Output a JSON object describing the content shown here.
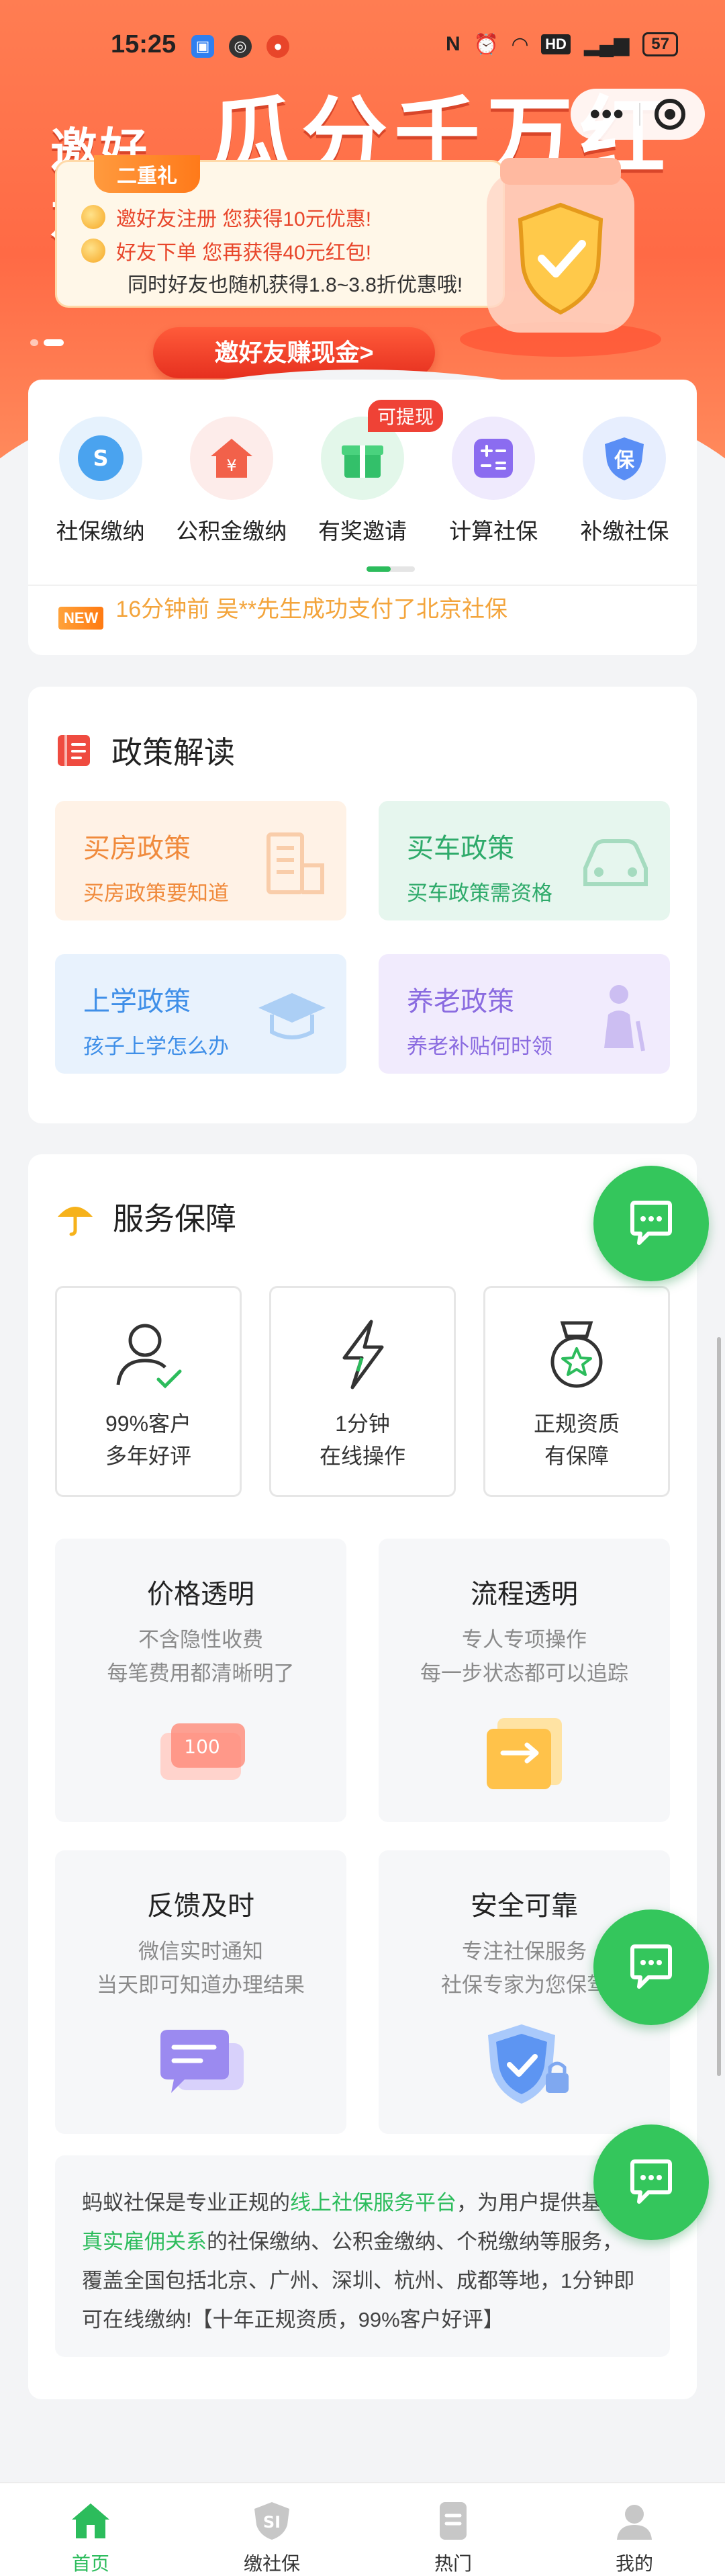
{
  "status_bar": {
    "time": "15:25",
    "battery": "57",
    "network": "HD"
  },
  "banner": {
    "headline_left": "邀好友",
    "headline_right": "瓜分千万红包",
    "gift_tag": "二重礼",
    "line1": "邀好友注册 您获得10元优惠!",
    "line2": "好友下单 您再获得40元红包!",
    "line3": "同时好友也随机获得1.8~3.8折优惠哦!",
    "invite_button": "邀好友赚现金>"
  },
  "quick_services": [
    {
      "label": "社保缴纳",
      "icon": "social-security-icon",
      "color": "#4aa3ef",
      "bg": "#e6f2fd"
    },
    {
      "label": "公积金缴纳",
      "icon": "housing-fund-icon",
      "color": "#f2614a",
      "bg": "#fdecea"
    },
    {
      "label": "有奖邀请",
      "icon": "gift-icon",
      "color": "#33c06a",
      "bg": "#e3f7ea",
      "badge": "可提现"
    },
    {
      "label": "计算社保",
      "icon": "calculator-icon",
      "color": "#8b6cf0",
      "bg": "#efeafd"
    },
    {
      "label": "补缴社保",
      "icon": "supplement-shield-icon",
      "color": "#5a8ef5",
      "bg": "#e7eefe"
    }
  ],
  "ticker": {
    "badge": "NEW",
    "text": "16分钟前 吴**先生成功支付了北京社保"
  },
  "policy": {
    "title": "政策解读",
    "cards": [
      {
        "title": "买房政策",
        "subtitle": "买房政策要知道",
        "color": "#f08a3c",
        "bg": "#fff2e6"
      },
      {
        "title": "买车政策",
        "subtitle": "买车政策需资格",
        "color": "#2eaa6a",
        "bg": "#e6f6ee"
      },
      {
        "title": "上学政策",
        "subtitle": "孩子上学怎么办",
        "color": "#3f8fe8",
        "bg": "#e8f2fd"
      },
      {
        "title": "养老政策",
        "subtitle": "养老补贴何时领",
        "color": "#8a6be0",
        "bg": "#f1ebfd"
      }
    ]
  },
  "service": {
    "title": "服务保障",
    "features": [
      {
        "line1": "99%客户",
        "line2": "多年好评"
      },
      {
        "line1": "1分钟",
        "line2": "在线操作"
      },
      {
        "line1": "正规资质",
        "line2": "有保障"
      }
    ],
    "promises": [
      {
        "title": "价格透明",
        "line1": "不含隐性收费",
        "line2": "每笔费用都清晰明了",
        "art_text": "100"
      },
      {
        "title": "流程透明",
        "line1": "专人专项操作",
        "line2": "每一步状态都可以追踪"
      },
      {
        "title": "反馈及时",
        "line1": "微信实时通知",
        "line2": "当天即可知道办理结果"
      },
      {
        "title": "安全可靠",
        "line1": "专注社保服务",
        "line2": "社保专家为您保驾"
      }
    ],
    "about": {
      "p1": "蚂蚁社保是专业正规的",
      "hl1": "线上社保服务平台",
      "p2": "，为用户提供基",
      "hl2": "于真实雇佣关系",
      "p3": "的社保缴纳、公积金缴纳、个税缴纳等服务，覆盖全国包括北京、广州、深圳、杭州、成都等地，1分钟即可在线缴纳!【十年正规资质，99%客户好评】"
    }
  },
  "bottom_nav": [
    {
      "label": "首页",
      "icon": "home-icon",
      "active": true
    },
    {
      "label": "缴社保",
      "icon": "social-security-tab-icon",
      "active": false
    },
    {
      "label": "热门",
      "icon": "hot-icon",
      "active": false
    },
    {
      "label": "我的",
      "icon": "profile-icon",
      "active": false
    }
  ],
  "colors": {
    "brand_green": "#2cbc5c",
    "banner_orange": "#ff6a45",
    "ticker_orange": "#f3a43b"
  }
}
